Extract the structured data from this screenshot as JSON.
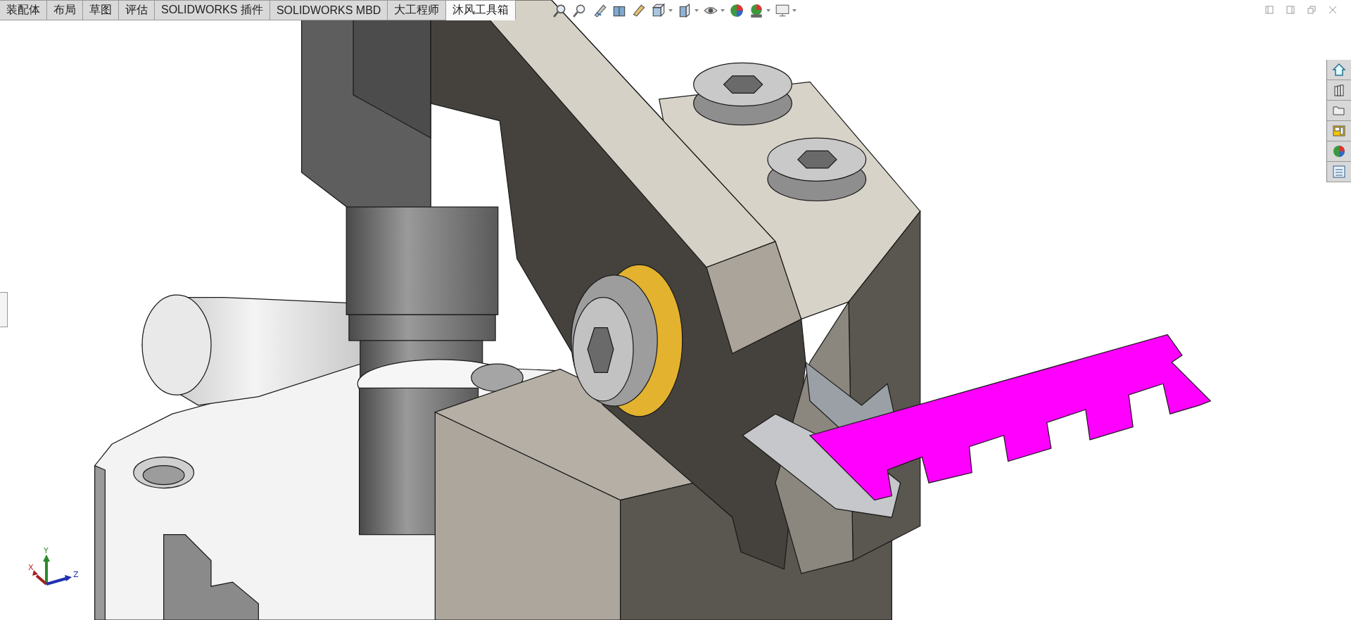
{
  "tabs": [
    {
      "label": "装配体",
      "selected": false
    },
    {
      "label": "布局",
      "selected": false
    },
    {
      "label": "草图",
      "selected": false
    },
    {
      "label": "评估",
      "selected": false
    },
    {
      "label": "SOLIDWORKS 插件",
      "selected": false
    },
    {
      "label": "SOLIDWORKS MBD",
      "selected": false
    },
    {
      "label": "大工程师",
      "selected": false
    },
    {
      "label": "沐风工具箱",
      "selected": true
    }
  ],
  "triad": {
    "x_label": "X",
    "y_label": "Y",
    "z_label": "Z"
  }
}
